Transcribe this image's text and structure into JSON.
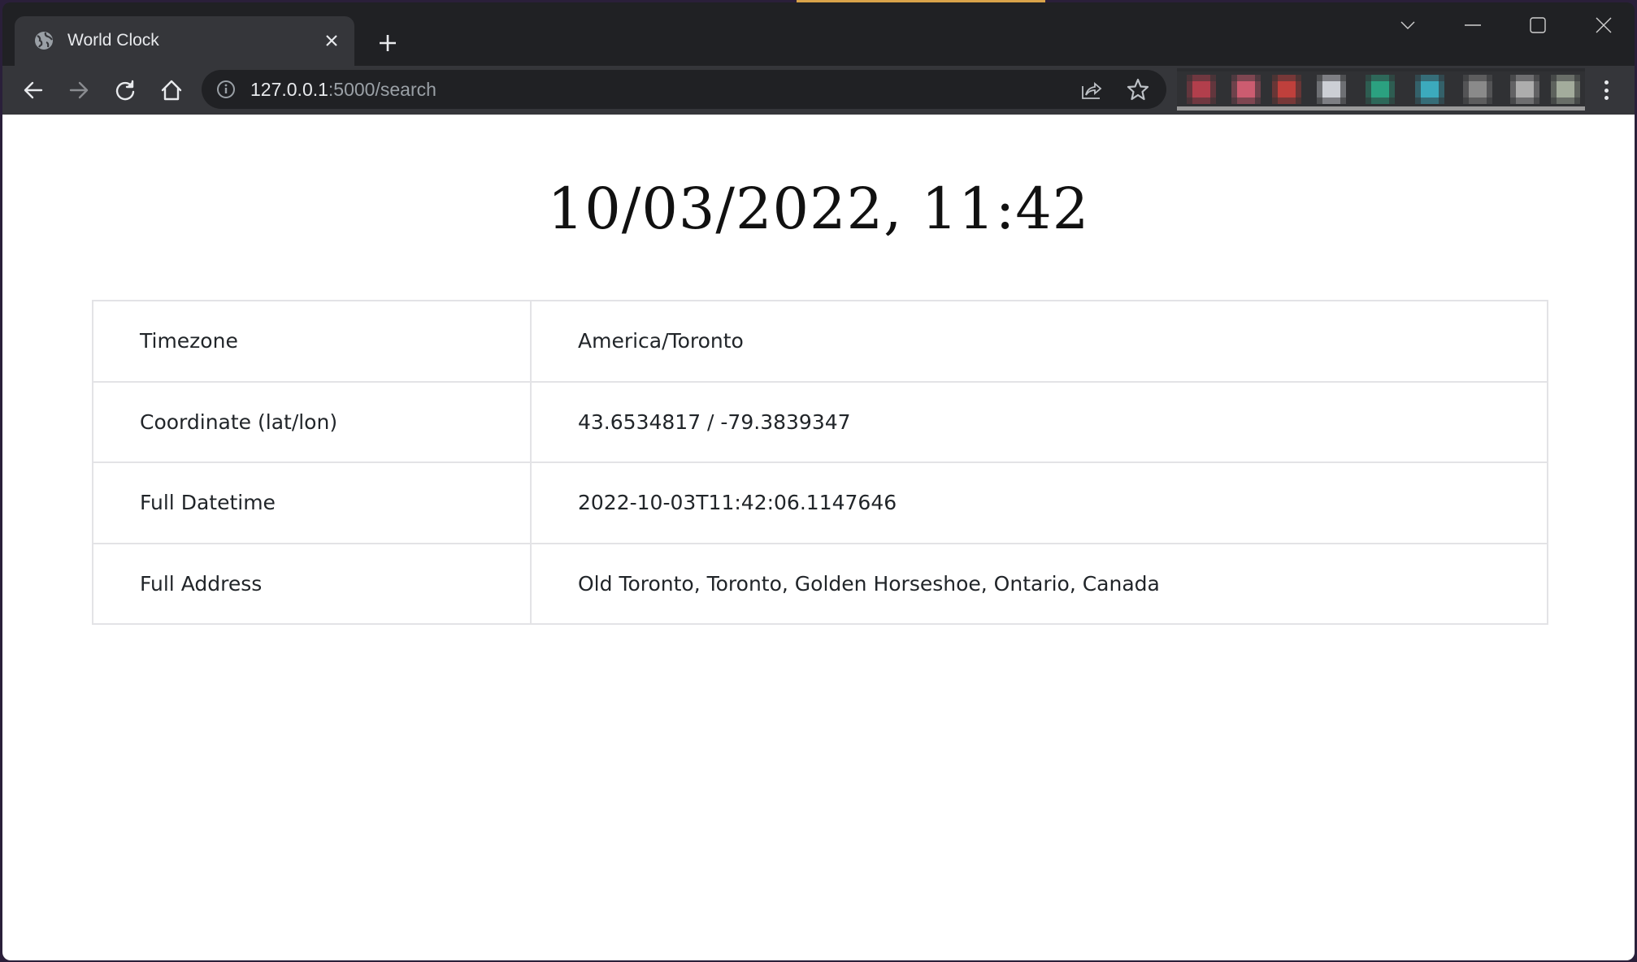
{
  "browser": {
    "tab": {
      "title": "World Clock",
      "favicon": "globe-icon",
      "close_icon": "close-icon"
    },
    "new_tab_label": "+",
    "window_controls": [
      "tab-search-chevron",
      "minimize",
      "maximize",
      "close"
    ],
    "toolbar": {
      "back_icon": "arrow-left-icon",
      "forward_icon": "arrow-right-icon",
      "reload_icon": "reload-icon",
      "home_icon": "home-icon"
    },
    "address_bar": {
      "host": "127.0.0.1",
      "rest": ":5000/search",
      "info_icon": "info-icon",
      "share_icon": "share-icon",
      "bookmark_icon": "star-icon"
    },
    "extensions": [
      {
        "color": "#c94252"
      },
      {
        "color": "#e8647c"
      },
      {
        "color": "#d9433f"
      },
      {
        "color": "#e8ecf2"
      },
      {
        "color": "#2bb58f"
      },
      {
        "color": "#3fc0d6"
      },
      {
        "color": "#9a9a9a"
      },
      {
        "color": "#c4c4c4"
      },
      {
        "color": "#b8c2b0"
      }
    ],
    "menu_icon": "kebab-menu-icon"
  },
  "page": {
    "heading": "10/03/2022, 11:42",
    "table": {
      "rows": [
        {
          "key": "Timezone",
          "value": "America/Toronto"
        },
        {
          "key": "Coordinate (lat/lon)",
          "value": "43.6534817 / -79.3839347"
        },
        {
          "key": "Full Datetime",
          "value": "2022-10-03T11:42:06.1147646"
        },
        {
          "key": "Full Address",
          "value": "Old Toronto, Toronto, Golden Horseshoe, Ontario, Canada"
        }
      ]
    }
  }
}
